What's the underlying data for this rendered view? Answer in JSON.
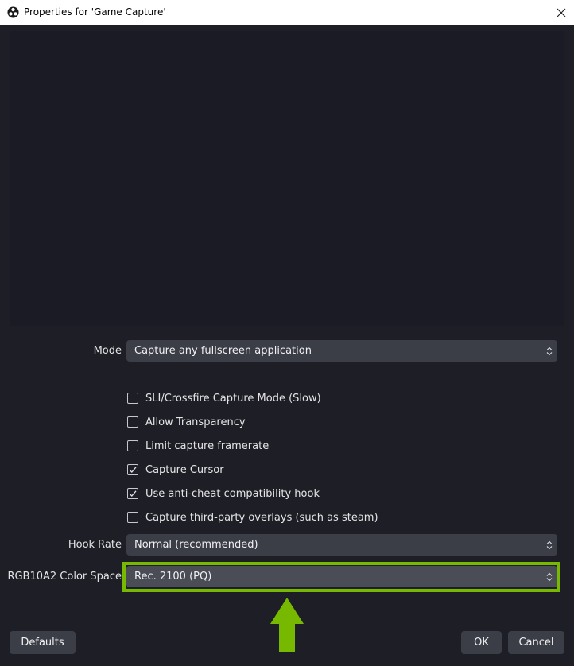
{
  "window": {
    "title": "Properties for 'Game Capture'",
    "app_icon": "obs-icon",
    "close_icon": "close-icon"
  },
  "form": {
    "mode": {
      "label": "Mode",
      "value": "Capture any fullscreen application"
    },
    "checkboxes": [
      {
        "label": "SLI/Crossfire Capture Mode (Slow)",
        "checked": false
      },
      {
        "label": "Allow Transparency",
        "checked": false
      },
      {
        "label": "Limit capture framerate",
        "checked": false
      },
      {
        "label": "Capture Cursor",
        "checked": true
      },
      {
        "label": "Use anti-cheat compatibility hook",
        "checked": true
      },
      {
        "label": "Capture third-party overlays (such as steam)",
        "checked": false
      }
    ],
    "hook_rate": {
      "label": "Hook Rate",
      "value": "Normal (recommended)"
    },
    "color_space": {
      "label": "RGB10A2 Color Space",
      "value": "Rec. 2100 (PQ)"
    }
  },
  "buttons": {
    "defaults": "Defaults",
    "ok": "OK",
    "cancel": "Cancel"
  },
  "annotation": {
    "highlight_color": "#76b900",
    "arrow_icon": "up-arrow-icon"
  },
  "colors": {
    "background": "#1e1f26",
    "control": "#3b3e47",
    "accent": "#76b900"
  }
}
